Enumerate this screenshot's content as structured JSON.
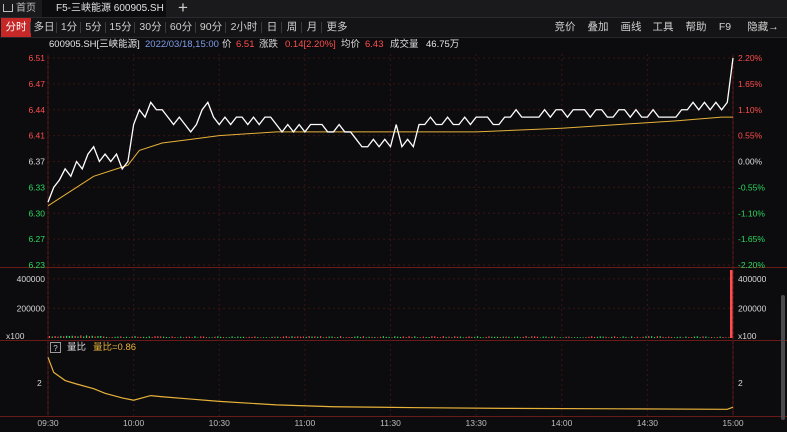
{
  "tabs": {
    "home": "首页",
    "stock": "F5-三峡能源 600905.SH",
    "add": "+"
  },
  "toolbar": {
    "periods": [
      "分时",
      "多日",
      "1分",
      "5分",
      "15分",
      "30分",
      "60分",
      "90分",
      "2小时",
      "日",
      "周",
      "月",
      "更多"
    ],
    "active_period": "分时",
    "right_buttons": [
      "竞价",
      "叠加",
      "画线",
      "工具",
      "帮助",
      "F9",
      "隐藏→"
    ]
  },
  "info": {
    "stock": "600905.SH[三峡能源]",
    "time": "2022/03/18,15:00",
    "price_label": "价",
    "price": "6.51",
    "change_label": "涨跌",
    "change": "0.14[2.20%]",
    "avg_label": "均价",
    "avg": "6.43",
    "volume_label": "成交量",
    "volume": "46.75万"
  },
  "indicator": {
    "q": "?",
    "name": "量比",
    "value": "量比=0.86"
  },
  "colors": {
    "up": "#ff4d4d",
    "down": "#2bd95e",
    "price_line": "#ffffff",
    "avg_line": "#e8b23a",
    "grid": "#3a1414",
    "active": "#c62828"
  },
  "chart_data": {
    "type": "line",
    "prev_close": 6.37,
    "price_ticks_left": [
      "6.51",
      "6.47",
      "6.44",
      "6.41",
      "6.37",
      "6.33",
      "6.30",
      "6.27",
      "6.23"
    ],
    "pct_ticks_right": [
      "2.20%",
      "1.65%",
      "1.10%",
      "0.55%",
      "0.00%",
      "-0.55%",
      "-1.10%",
      "-1.65%",
      "-2.20%"
    ],
    "price_ylim": [
      6.23,
      6.51
    ],
    "x_ticks": [
      "09:30",
      "10:00",
      "10:30",
      "11:00",
      "11:30",
      "13:30",
      "14:00",
      "14:30",
      "15:00"
    ],
    "x_total_minutes": 240,
    "price": [
      [
        0,
        6.315
      ],
      [
        2,
        6.335
      ],
      [
        4,
        6.345
      ],
      [
        6,
        6.36
      ],
      [
        8,
        6.35
      ],
      [
        10,
        6.37
      ],
      [
        12,
        6.36
      ],
      [
        14,
        6.38
      ],
      [
        16,
        6.39
      ],
      [
        18,
        6.37
      ],
      [
        20,
        6.38
      ],
      [
        22,
        6.37
      ],
      [
        24,
        6.38
      ],
      [
        26,
        6.36
      ],
      [
        28,
        6.37
      ],
      [
        30,
        6.42
      ],
      [
        32,
        6.44
      ],
      [
        34,
        6.43
      ],
      [
        36,
        6.45
      ],
      [
        38,
        6.44
      ],
      [
        40,
        6.44
      ],
      [
        42,
        6.43
      ],
      [
        44,
        6.42
      ],
      [
        46,
        6.43
      ],
      [
        48,
        6.42
      ],
      [
        50,
        6.41
      ],
      [
        52,
        6.42
      ],
      [
        54,
        6.44
      ],
      [
        56,
        6.45
      ],
      [
        58,
        6.43
      ],
      [
        60,
        6.42
      ],
      [
        62,
        6.43
      ],
      [
        64,
        6.42
      ],
      [
        66,
        6.43
      ],
      [
        68,
        6.43
      ],
      [
        70,
        6.42
      ],
      [
        72,
        6.43
      ],
      [
        74,
        6.42
      ],
      [
        76,
        6.43
      ],
      [
        78,
        6.43
      ],
      [
        80,
        6.42
      ],
      [
        82,
        6.41
      ],
      [
        84,
        6.42
      ],
      [
        86,
        6.41
      ],
      [
        88,
        6.42
      ],
      [
        90,
        6.41
      ],
      [
        92,
        6.42
      ],
      [
        94,
        6.42
      ],
      [
        96,
        6.42
      ],
      [
        98,
        6.41
      ],
      [
        100,
        6.41
      ],
      [
        102,
        6.42
      ],
      [
        104,
        6.41
      ],
      [
        106,
        6.41
      ],
      [
        108,
        6.4
      ],
      [
        110,
        6.39
      ],
      [
        112,
        6.39
      ],
      [
        114,
        6.4
      ],
      [
        116,
        6.39
      ],
      [
        118,
        6.4
      ],
      [
        120,
        6.39
      ],
      [
        122,
        6.42
      ],
      [
        124,
        6.39
      ],
      [
        126,
        6.4
      ],
      [
        128,
        6.39
      ],
      [
        130,
        6.42
      ],
      [
        132,
        6.42
      ],
      [
        134,
        6.43
      ],
      [
        136,
        6.42
      ],
      [
        138,
        6.42
      ],
      [
        140,
        6.43
      ],
      [
        142,
        6.42
      ],
      [
        144,
        6.42
      ],
      [
        146,
        6.43
      ],
      [
        148,
        6.42
      ],
      [
        150,
        6.43
      ],
      [
        152,
        6.43
      ],
      [
        154,
        6.43
      ],
      [
        156,
        6.42
      ],
      [
        158,
        6.42
      ],
      [
        160,
        6.43
      ],
      [
        162,
        6.43
      ],
      [
        164,
        6.44
      ],
      [
        166,
        6.43
      ],
      [
        168,
        6.43
      ],
      [
        170,
        6.43
      ],
      [
        172,
        6.43
      ],
      [
        174,
        6.44
      ],
      [
        176,
        6.43
      ],
      [
        178,
        6.44
      ],
      [
        180,
        6.44
      ],
      [
        182,
        6.43
      ],
      [
        184,
        6.44
      ],
      [
        186,
        6.44
      ],
      [
        188,
        6.44
      ],
      [
        190,
        6.43
      ],
      [
        192,
        6.44
      ],
      [
        194,
        6.44
      ],
      [
        196,
        6.43
      ],
      [
        198,
        6.43
      ],
      [
        200,
        6.44
      ],
      [
        202,
        6.44
      ],
      [
        204,
        6.43
      ],
      [
        206,
        6.44
      ],
      [
        208,
        6.43
      ],
      [
        210,
        6.43
      ],
      [
        212,
        6.44
      ],
      [
        214,
        6.43
      ],
      [
        216,
        6.43
      ],
      [
        218,
        6.43
      ],
      [
        220,
        6.43
      ],
      [
        222,
        6.44
      ],
      [
        224,
        6.44
      ],
      [
        226,
        6.45
      ],
      [
        228,
        6.44
      ],
      [
        230,
        6.45
      ],
      [
        232,
        6.44
      ],
      [
        234,
        6.45
      ],
      [
        236,
        6.44
      ],
      [
        238,
        6.45
      ],
      [
        240,
        6.51
      ]
    ],
    "avg": [
      [
        0,
        6.31
      ],
      [
        8,
        6.33
      ],
      [
        16,
        6.35
      ],
      [
        24,
        6.36
      ],
      [
        28,
        6.365
      ],
      [
        32,
        6.385
      ],
      [
        40,
        6.395
      ],
      [
        50,
        6.4
      ],
      [
        60,
        6.405
      ],
      [
        80,
        6.41
      ],
      [
        100,
        6.41
      ],
      [
        120,
        6.41
      ],
      [
        150,
        6.41
      ],
      [
        180,
        6.415
      ],
      [
        200,
        6.42
      ],
      [
        220,
        6.425
      ],
      [
        236,
        6.43
      ],
      [
        240,
        6.43
      ]
    ],
    "volume_ticks": [
      "400000",
      "200000"
    ],
    "volume_unit": "x100",
    "volume_ylim": [
      0,
      460000
    ],
    "volume_note": "per-minute volume bars (x100), last bar ≈ 460000",
    "volume_last": 460000,
    "ratio_tick": "2",
    "ratio_ylim": [
      0.7,
      3.2
    ],
    "ratio": [
      [
        0,
        3.1
      ],
      [
        2,
        2.45
      ],
      [
        6,
        2.1
      ],
      [
        10,
        1.95
      ],
      [
        16,
        1.75
      ],
      [
        20,
        1.55
      ],
      [
        26,
        1.35
      ],
      [
        30,
        1.25
      ],
      [
        36,
        1.45
      ],
      [
        40,
        1.4
      ],
      [
        50,
        1.3
      ],
      [
        60,
        1.2
      ],
      [
        80,
        1.05
      ],
      [
        100,
        0.97
      ],
      [
        130,
        0.93
      ],
      [
        160,
        0.9
      ],
      [
        200,
        0.88
      ],
      [
        238,
        0.86
      ],
      [
        240,
        0.95
      ]
    ]
  }
}
